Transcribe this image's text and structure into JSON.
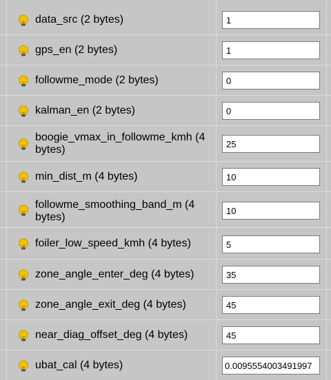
{
  "params": [
    {
      "label": "data_src (2 bytes)",
      "value": "1"
    },
    {
      "label": "gps_en (2 bytes)",
      "value": "1"
    },
    {
      "label": "followme_mode (2 bytes)",
      "value": "0"
    },
    {
      "label": "kalman_en (2 bytes)",
      "value": "0"
    },
    {
      "label": "boogie_vmax_in_followme_kmh (4 bytes)",
      "value": "25"
    },
    {
      "label": "min_dist_m (4 bytes)",
      "value": "10"
    },
    {
      "label": "followme_smoothing_band_m (4 bytes)",
      "value": "10"
    },
    {
      "label": "foiler_low_speed_kmh (4 bytes)",
      "value": "5"
    },
    {
      "label": "zone_angle_enter_deg (4 bytes)",
      "value": "35"
    },
    {
      "label": "zone_angle_exit_deg (4 bytes)",
      "value": "45"
    },
    {
      "label": "near_diag_offset_deg (4 bytes)",
      "value": "45"
    },
    {
      "label": "ubat_cal (4 bytes)",
      "value": "0.0095554003491997"
    }
  ],
  "icon": "lightbulb-icon",
  "colors": {
    "background": "#c6c6c6",
    "grid_line": "#dcdcdc",
    "bulb": "#f2c200"
  }
}
